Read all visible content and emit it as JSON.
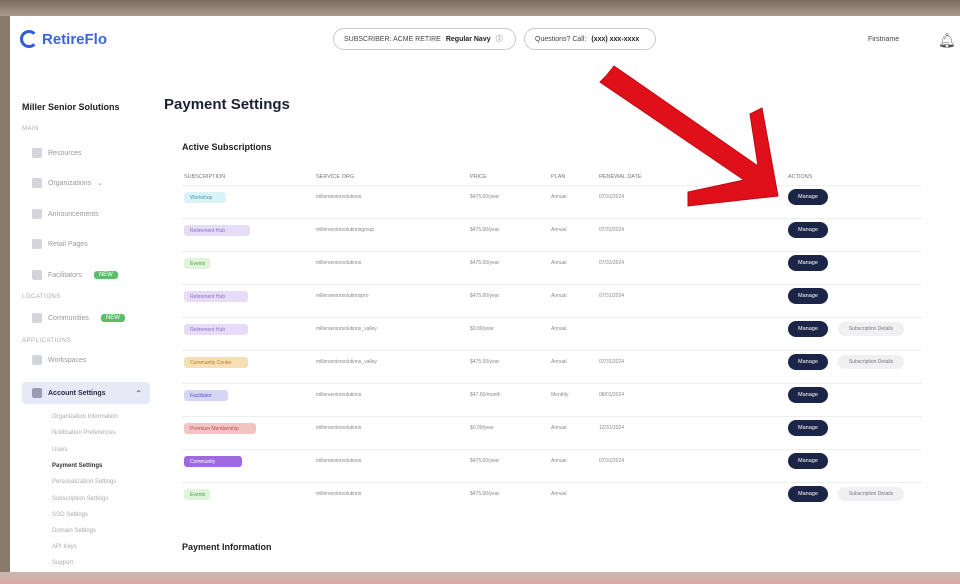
{
  "colors": {
    "brand": "#3a66e0",
    "primary_button": "#1c2547",
    "arrow": "#e0101a",
    "badge_green": "#5bbf6a"
  },
  "header": {
    "logo_text": "RetireFlo",
    "pill1": {
      "text": "SUBSCRIBER: ACME RETIRE",
      "value": "Regular Navy"
    },
    "pill2": {
      "text": "Questions? Call:",
      "value": "(xxx) xxx-xxxx"
    },
    "user_name": "Firstname",
    "bell_icon": "bell-icon"
  },
  "sidebar": {
    "org_name": "Miller Senior Solutions",
    "sections": [
      "MAIN",
      "LOCATIONS",
      "APPLICATIONS"
    ],
    "items": [
      {
        "label": "Resources",
        "icon": "home-icon",
        "badge": ""
      },
      {
        "label": "Organizations",
        "icon": "building-icon",
        "badge": ""
      },
      {
        "label": "Announcements",
        "icon": "megaphone-icon",
        "badge": ""
      },
      {
        "label": "Retail Pages",
        "icon": "page-icon",
        "badge": ""
      },
      {
        "label": "Facilitators",
        "icon": "people-icon",
        "badge": "NEW"
      },
      {
        "label": "Communities",
        "icon": "location-icon",
        "badge": "NEW"
      },
      {
        "label": "Workspaces",
        "icon": "grid-icon",
        "badge": ""
      },
      {
        "label": "Account Settings",
        "icon": "gear-icon",
        "badge": ""
      }
    ],
    "sub_items": [
      "Organization Information",
      "Notification Preferences",
      "Users",
      "Payment Settings",
      "Personalization Settings",
      "Subscription Settings",
      "SSO Settings",
      "Domain Settings",
      "API Keys",
      "Support"
    ]
  },
  "main": {
    "page_title": "Payment Settings",
    "subscriptions_title": "Active Subscriptions",
    "payment_info_title": "Payment Information",
    "columns": [
      "Subscription",
      "Service Org",
      "Price",
      "Plan",
      "Renewal Date",
      "Actions"
    ],
    "rows": [
      {
        "tag": "Workshop",
        "org": "millerseniorsolutions",
        "price": "$475.00/year",
        "plan": "Annual",
        "renewal": "07/31/2024",
        "action": "Manage",
        "extra": ""
      },
      {
        "tag": "Retirement Hub",
        "org": "millerseniorsolutionsgroup",
        "price": "$475.00/year",
        "plan": "Annual",
        "renewal": "07/31/2024",
        "action": "Manage",
        "extra": ""
      },
      {
        "tag": "Events",
        "org": "millerseniorsolutions",
        "price": "$475.00/year",
        "plan": "Annual",
        "renewal": "07/31/2024",
        "action": "Manage",
        "extra": ""
      },
      {
        "tag": "Retirement Hub",
        "org": "millerseniorsolutionspro",
        "price": "$475.00/year",
        "plan": "Annual",
        "renewal": "07/31/2024",
        "action": "Manage",
        "extra": ""
      },
      {
        "tag": "Retirement Hub",
        "org": "millerseniorsolutions_valley",
        "price": "$0.00/year",
        "plan": "Annual",
        "renewal": "",
        "action": "Manage",
        "extra": "Subscription Details"
      },
      {
        "tag": "Community Center",
        "org": "millerseniorsolutions_valley",
        "price": "$475.00/year",
        "plan": "Annual",
        "renewal": "07/31/2024",
        "action": "Manage",
        "extra": "Subscription Details"
      },
      {
        "tag": "Facilitator",
        "org": "millerseniorsolutions",
        "price": "$47.50/month",
        "plan": "Monthly",
        "renewal": "08/01/2024",
        "action": "Manage",
        "extra": ""
      },
      {
        "tag": "Premium Membership",
        "org": "millerseniorsolutions",
        "price": "$0.00/year",
        "plan": "Annual",
        "renewal": "12/31/2024",
        "action": "Manage",
        "extra": ""
      },
      {
        "tag": "Community",
        "org": "millerseniorsolutions",
        "price": "$475.00/year",
        "plan": "Annual",
        "renewal": "07/31/2024",
        "action": "Manage",
        "extra": ""
      },
      {
        "tag": "Events",
        "org": "millerseniorsolutions",
        "price": "$475.00/year",
        "plan": "Annual",
        "renewal": "",
        "action": "Manage",
        "extra": "Subscription Details"
      }
    ],
    "tag_colors": [
      [
        "#d9f3f6",
        "#3a9fb0"
      ],
      [
        "#e6dcf7",
        "#8b6bc9"
      ],
      [
        "#dff4d9",
        "#4da14a"
      ],
      [
        "#e6dcf7",
        "#8b6bc9"
      ],
      [
        "#e6dcf7",
        "#8b6bc9"
      ],
      [
        "#f6dfb4",
        "#b87a1f"
      ],
      [
        "#d5d6f6",
        "#5256c0"
      ],
      [
        "#f2c4c4",
        "#c24a4a"
      ],
      [
        "#9c69de",
        "#ffffff"
      ],
      [
        "#dff4d9",
        "#4da14a"
      ]
    ]
  }
}
